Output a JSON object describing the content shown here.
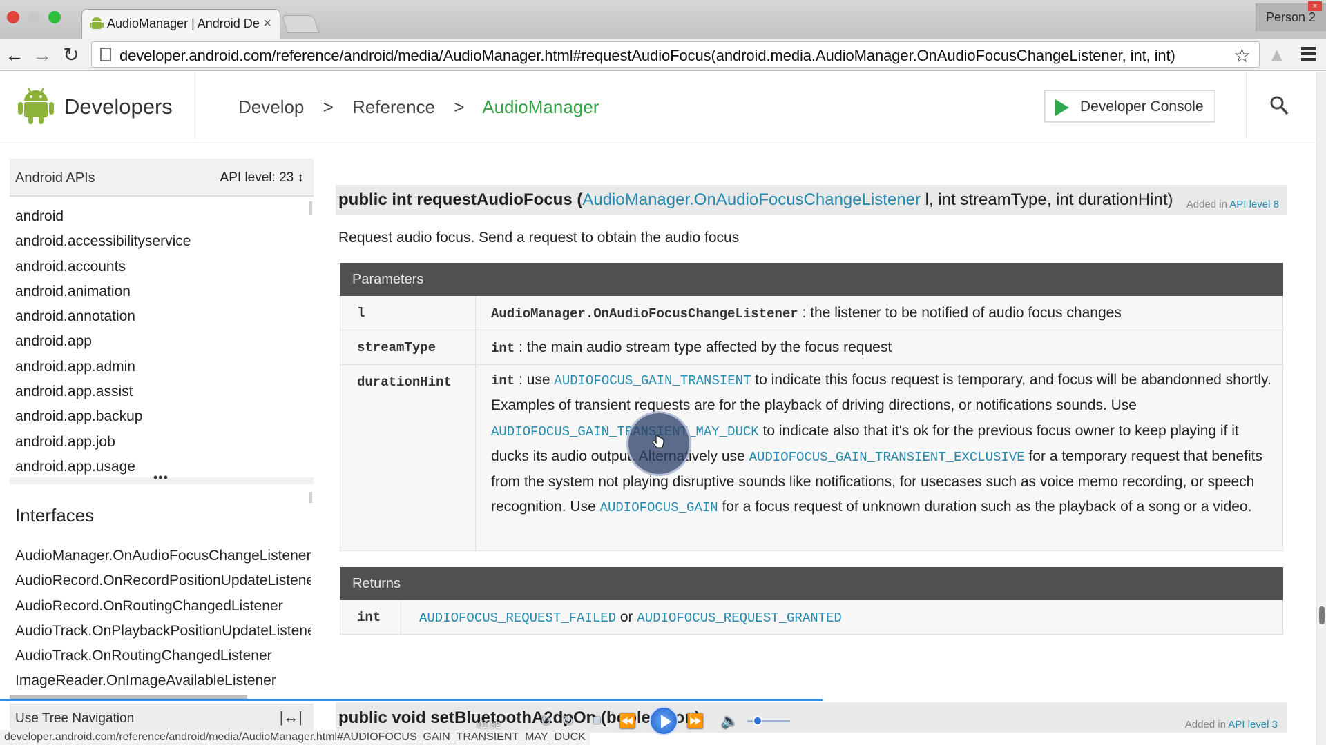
{
  "browser": {
    "tab_title": "AudioManager | Android De",
    "profile_label": "Person 2",
    "url": "developer.android.com/reference/android/media/AudioManager.html#requestAudioFocus(android.media.AudioManager.OnAudioFocusChangeListener, int, int)",
    "status_url": "developer.android.com/reference/android/media/AudioManager.html#AUDIOFOCUS_GAIN_TRANSIENT_MAY_DUCK"
  },
  "header": {
    "brand": "Developers",
    "crumbs": [
      "Develop",
      ">",
      "Reference",
      ">",
      "AudioManager"
    ],
    "console_label": "Developer Console"
  },
  "sidebar": {
    "api_title": "Android APIs",
    "api_level": "API level: 23 ↕",
    "packages": [
      "android",
      "android.accessibilityservice",
      "android.accounts",
      "android.animation",
      "android.annotation",
      "android.app",
      "android.app.admin",
      "android.app.assist",
      "android.app.backup",
      "android.app.job",
      "android.app.usage"
    ],
    "more": "•••",
    "interfaces_title": "Interfaces",
    "interfaces": [
      "AudioManager.OnAudioFocusChangeListener",
      "AudioRecord.OnRecordPositionUpdateListener",
      "AudioRecord.OnRoutingChangedListener",
      "AudioTrack.OnPlaybackPositionUpdateListener",
      "AudioTrack.OnRoutingChangedListener",
      "ImageReader.OnImageAvailableListener"
    ],
    "tree_label": "Use Tree Navigation"
  },
  "method": {
    "sig_prefix": "public int requestAudioFocus (",
    "sig_link": "AudioManager.OnAudioFocusChangeListener",
    "sig_suffix": " l, int streamType, int durationHint)",
    "added_prefix": "Added in ",
    "added_link": "API level 8",
    "description": "Request audio focus. Send a request to obtain the audio focus"
  },
  "parameters": {
    "heading": "Parameters",
    "rows": [
      {
        "name": "l",
        "type": "AudioManager.OnAudioFocusChangeListener",
        "text": " : the listener to be notified of audio focus changes"
      },
      {
        "name": "streamType",
        "type": "int",
        "text": " : the main audio stream type affected by the focus request"
      }
    ],
    "duration": {
      "name": "durationHint",
      "type": "int",
      "t1": " : use ",
      "c1": "AUDIOFOCUS_GAIN_TRANSIENT",
      "t2": " to indicate this focus request is temporary, and focus will be abandonned shortly. Examples of transient requests are for the playback of driving directions, or notifications sounds. Use ",
      "c2": "AUDIOFOCUS_GAIN_TRANSIENT_MAY_DUCK",
      "t3": " to indicate also that it's ok for the previous focus owner to keep playing if it ducks its audio output. Alternatively use ",
      "c3": "AUDIOFOCUS_GAIN_TRANSIENT_EXCLUSIVE",
      "t4": " for a temporary request that benefits from the system not playing disruptive sounds like notifications, for usecases such as voice memo recording, or speech recognition. Use ",
      "c4": "AUDIOFOCUS_GAIN",
      "t5": " for a focus request of unknown duration such as the playback of a song or a video."
    }
  },
  "returns": {
    "heading": "Returns",
    "type": "int",
    "c1": "AUDIOFOCUS_REQUEST_FAILED",
    "or": " or ",
    "c2": "AUDIOFOCUS_REQUEST_GRANTED"
  },
  "next_method": {
    "sig": "public void setBluetoothA2dpOn (boolean on)",
    "added_prefix": "Added in ",
    "added_link": "API level 3"
  },
  "player": {
    "time": "01:32",
    "stop": "■",
    "rewind": "⏪",
    "forward": "⏩",
    "volume": "🔈",
    "loop": "↻",
    "progress": 0.625
  },
  "colors": {
    "brand_green": "#37a348",
    "link_blue": "#258aaf",
    "table_header": "#505050"
  }
}
